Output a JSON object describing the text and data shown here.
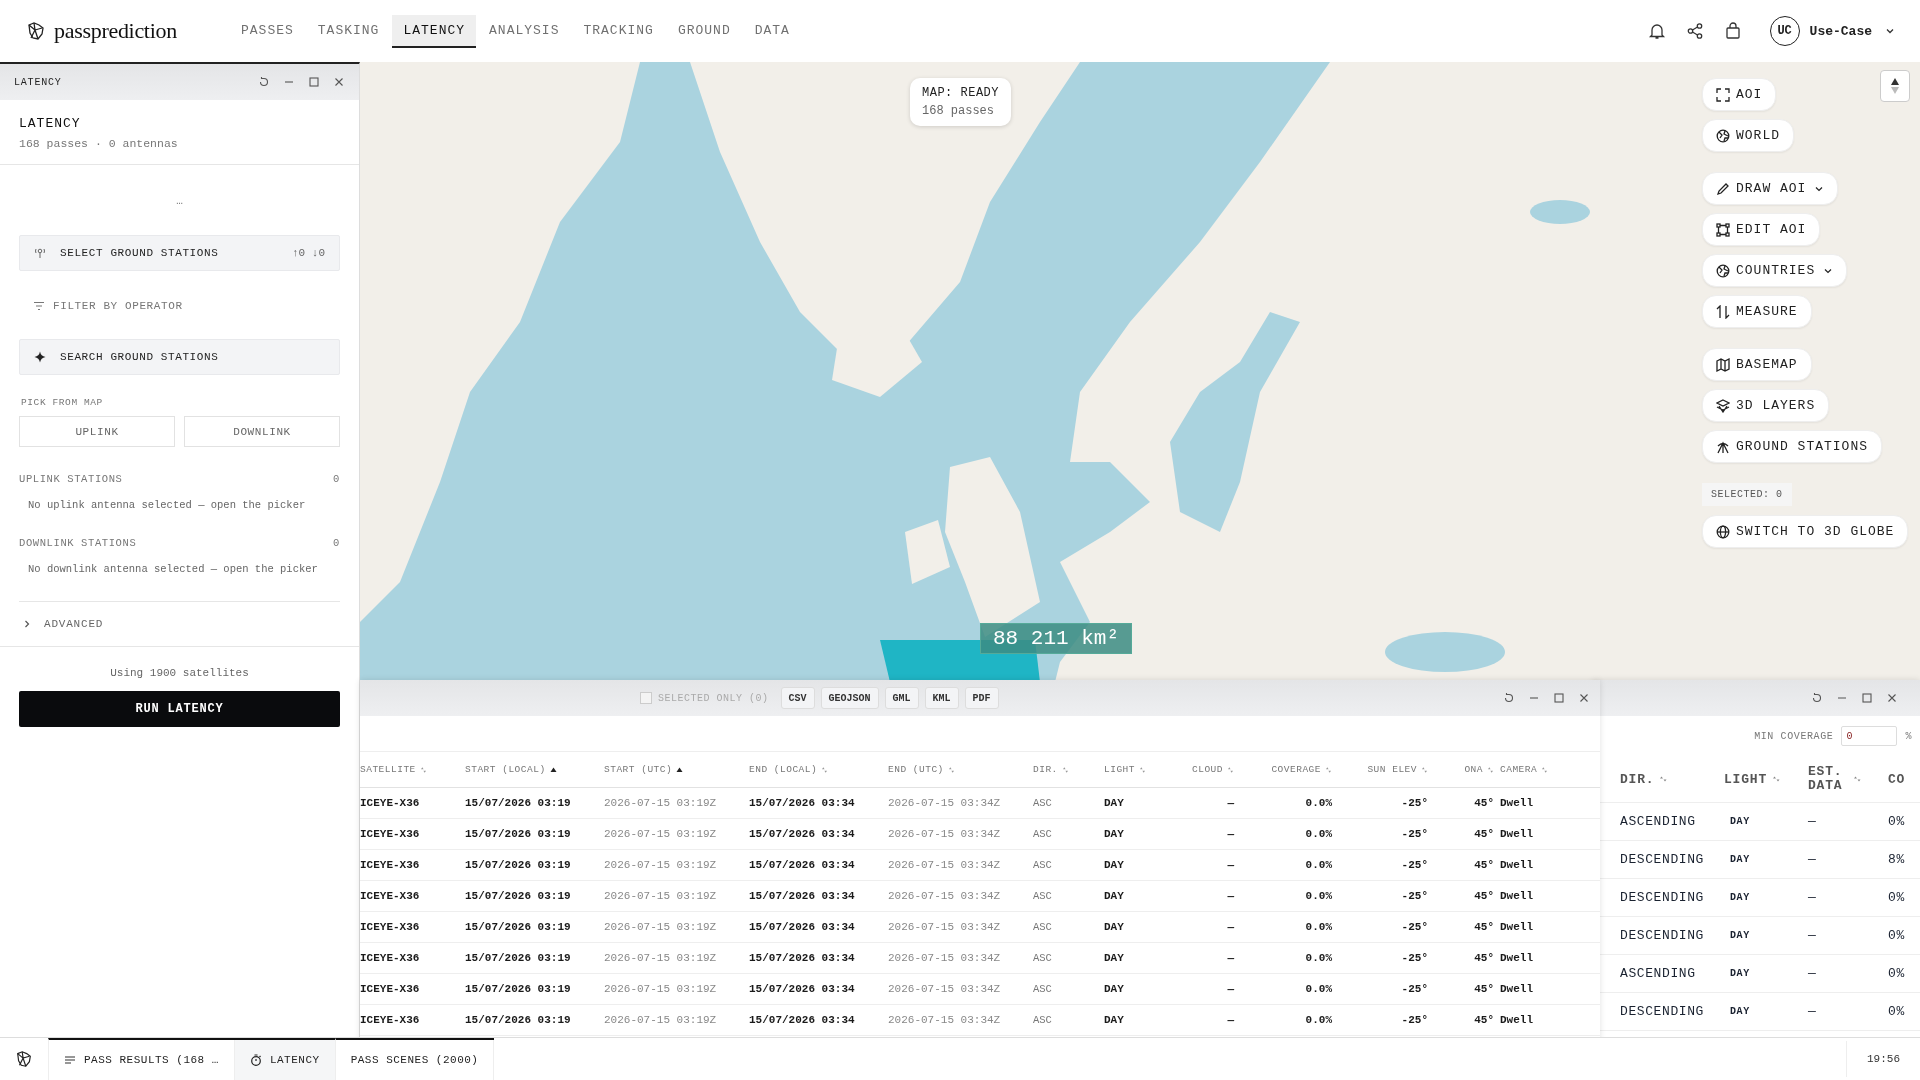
{
  "app": {
    "name": "passprediction"
  },
  "nav": [
    {
      "label": "PASSES",
      "selected": false
    },
    {
      "label": "TASKING",
      "selected": false
    },
    {
      "label": "LATENCY",
      "selected": true
    },
    {
      "label": "ANALYSIS",
      "selected": false
    },
    {
      "label": "TRACKING",
      "selected": false
    },
    {
      "label": "GROUND",
      "selected": false
    },
    {
      "label": "DATA",
      "selected": false
    }
  ],
  "user": {
    "initials": "UC",
    "name": "Use-Case"
  },
  "map": {
    "status": "MAP: READY",
    "passes": "168 passes",
    "measurement": "88 211 km²",
    "tool_groups": [
      {
        "tools": [
          {
            "label": "AOI",
            "dropdown": false
          },
          {
            "label": "WORLD",
            "dropdown": false
          }
        ]
      },
      {
        "tools": [
          {
            "label": "DRAW AOI",
            "dropdown": true
          },
          {
            "label": "EDIT AOI",
            "dropdown": false
          },
          {
            "label": "COUNTRIES",
            "dropdown": true
          },
          {
            "label": "MEASURE",
            "dropdown": false
          }
        ]
      },
      {
        "tools": [
          {
            "label": "BASEMAP",
            "dropdown": false
          },
          {
            "label": "3D LAYERS",
            "dropdown": false
          },
          {
            "label": "GROUND STATIONS",
            "dropdown": false
          }
        ]
      }
    ],
    "selected_count": "SELECTED: 0",
    "globe_button": "SWITCH TO 3D GLOBE"
  },
  "latency_panel": {
    "window_title": "LATENCY",
    "title": "LATENCY",
    "subtitle": "168 passes · 0 antennas",
    "loading": "…",
    "select_button": {
      "label": "SELECT GROUND STATIONS",
      "uplink_count": "↑0",
      "downlink_count": "↓0"
    },
    "filter": "FILTER BY OPERATOR",
    "search": "SEARCH GROUND STATIONS",
    "pick_label": "PICK FROM MAP",
    "pick_buttons": [
      "UPLINK",
      "DOWNLINK"
    ],
    "sections": [
      {
        "title": "UPLINK STATIONS",
        "count": "0",
        "empty": "No uplink antenna selected — open the picker"
      },
      {
        "title": "DOWNLINK STATIONS",
        "count": "0",
        "empty": "No downlink antenna selected — open the picker"
      }
    ],
    "advanced": {
      "label": "ADVANCED",
      "expanded": false
    },
    "footnote": "Using 1900 satellites",
    "run_button": "RUN LATENCY"
  },
  "results": {
    "selected_only": {
      "label": "SELECTED ONLY (0)",
      "checked": false
    },
    "exports": [
      "CSV",
      "GEOJSON",
      "GML",
      "KML",
      "PDF"
    ],
    "columns": [
      {
        "label": "SATELLITE",
        "sorted": false
      },
      {
        "label": "START (LOCAL)",
        "sorted": true
      },
      {
        "label": "START (UTC)",
        "sorted": true
      },
      {
        "label": "END (LOCAL)",
        "sorted": false
      },
      {
        "label": "END (UTC)",
        "sorted": false
      },
      {
        "label": "DIR.",
        "sorted": false
      },
      {
        "label": "LIGHT",
        "sorted": false
      },
      {
        "label": "CLOUD",
        "sorted": false
      },
      {
        "label": "COVERAGE",
        "sorted": false
      },
      {
        "label": "SUN ELEV",
        "sorted": false
      },
      {
        "label": "ONA",
        "sorted": false
      },
      {
        "label": "CAMERA",
        "sorted": false
      }
    ],
    "rows": [
      [
        "ICEYE-X36",
        "15/07/2026 03:19",
        "2026-07-15 03:19Z",
        "15/07/2026 03:34",
        "2026-07-15 03:34Z",
        "ASC",
        "DAY",
        "—",
        "0.0%",
        "-25°",
        "45°",
        "Dwell"
      ],
      [
        "ICEYE-X36",
        "15/07/2026 03:19",
        "2026-07-15 03:19Z",
        "15/07/2026 03:34",
        "2026-07-15 03:34Z",
        "ASC",
        "DAY",
        "—",
        "0.0%",
        "-25°",
        "45°",
        "Dwell"
      ],
      [
        "ICEYE-X36",
        "15/07/2026 03:19",
        "2026-07-15 03:19Z",
        "15/07/2026 03:34",
        "2026-07-15 03:34Z",
        "ASC",
        "DAY",
        "—",
        "0.0%",
        "-25°",
        "45°",
        "Dwell"
      ],
      [
        "ICEYE-X36",
        "15/07/2026 03:19",
        "2026-07-15 03:19Z",
        "15/07/2026 03:34",
        "2026-07-15 03:34Z",
        "ASC",
        "DAY",
        "—",
        "0.0%",
        "-25°",
        "45°",
        "Dwell"
      ],
      [
        "ICEYE-X36",
        "15/07/2026 03:19",
        "2026-07-15 03:19Z",
        "15/07/2026 03:34",
        "2026-07-15 03:34Z",
        "ASC",
        "DAY",
        "—",
        "0.0%",
        "-25°",
        "45°",
        "Dwell"
      ],
      [
        "ICEYE-X36",
        "15/07/2026 03:19",
        "2026-07-15 03:19Z",
        "15/07/2026 03:34",
        "2026-07-15 03:34Z",
        "ASC",
        "DAY",
        "—",
        "0.0%",
        "-25°",
        "45°",
        "Dwell"
      ],
      [
        "ICEYE-X36",
        "15/07/2026 03:19",
        "2026-07-15 03:19Z",
        "15/07/2026 03:34",
        "2026-07-15 03:34Z",
        "ASC",
        "DAY",
        "—",
        "0.0%",
        "-25°",
        "45°",
        "Dwell"
      ],
      [
        "ICEYE-X36",
        "15/07/2026 03:19",
        "2026-07-15 03:19Z",
        "15/07/2026 03:34",
        "2026-07-15 03:34Z",
        "ASC",
        "DAY",
        "—",
        "0.0%",
        "-25°",
        "45°",
        "Dwell"
      ]
    ]
  },
  "scenes": {
    "min_coverage": {
      "label": "MIN COVERAGE",
      "value": "0",
      "unit": "%"
    },
    "columns": [
      {
        "label": "DIR."
      },
      {
        "label": "LIGHT"
      },
      {
        "label": "EST. DATA"
      },
      {
        "label": "CO"
      }
    ],
    "rows": [
      [
        "ASCENDING",
        "DAY",
        "—",
        "0%"
      ],
      [
        "DESCENDING",
        "DAY",
        "—",
        "8%"
      ],
      [
        "DESCENDING",
        "DAY",
        "—",
        "0%"
      ],
      [
        "DESCENDING",
        "DAY",
        "—",
        "0%"
      ],
      [
        "ASCENDING",
        "DAY",
        "—",
        "0%"
      ],
      [
        "DESCENDING",
        "DAY",
        "—",
        "0%"
      ]
    ]
  },
  "taskbar": {
    "tabs": [
      {
        "label": "PASS RESULTS (168 …",
        "selected": false
      },
      {
        "label": "LATENCY",
        "selected": true
      },
      {
        "label": "PASS SCENES (2000)",
        "selected": false
      }
    ],
    "clock": "19:56"
  }
}
